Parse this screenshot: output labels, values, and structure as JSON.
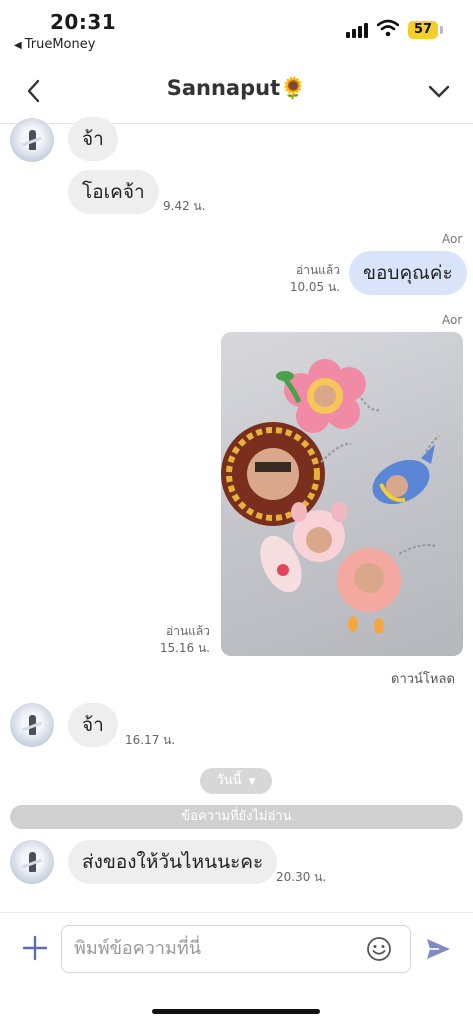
{
  "status_bar": {
    "time": "20:31",
    "back_app": "TrueMoney",
    "battery": "57"
  },
  "header": {
    "title": "Sannaput🌻"
  },
  "messages": [
    {
      "side": "left",
      "text": "จ้า"
    },
    {
      "side": "left",
      "text": "โอเคจ้า",
      "time": "9.42 น."
    },
    {
      "side": "right",
      "sender": "Aor",
      "text": "ขอบคุณค่ะ",
      "read": "อ่านแล้ว",
      "time": "10.05 น."
    },
    {
      "side": "right",
      "sender": "Aor",
      "type": "image",
      "read": "อ่านแล้ว",
      "time": "15.16 น.",
      "download": "ดาวน์โหลด"
    },
    {
      "side": "left",
      "text": "จ้า",
      "time": "16.17 น."
    },
    {
      "side": "left",
      "text": "ส่งของให้วันไหนนะคะ",
      "time": "20.30 น."
    }
  ],
  "date_separator": "วันนี้",
  "unread_separator": "ข้อความที่ยังไม่อ่าน",
  "input": {
    "placeholder": "พิมพ์ข้อความที่นี่"
  },
  "colors": {
    "my_bubble": "#d9e4fb",
    "their_bubble": "#eeeeee",
    "accent": "#5b6bb5",
    "battery": "#f4cf2a"
  }
}
